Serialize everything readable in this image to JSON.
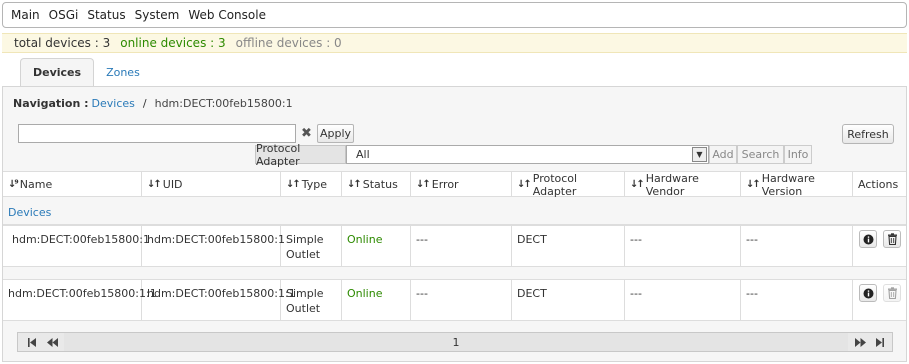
{
  "menu": [
    "Main",
    "OSGi",
    "Status",
    "System",
    "Web Console"
  ],
  "status": {
    "total": "total devices : 3",
    "online": "online devices : 3",
    "offline": "offline devices : 0"
  },
  "tabs": [
    {
      "label": "Devices",
      "active": true
    },
    {
      "label": "Zones",
      "active": false
    }
  ],
  "navigation": {
    "label": "Navigation :",
    "link": "Devices",
    "separator": "/",
    "current": "hdm:DECT:00feb15800:1"
  },
  "filter": {
    "value": "",
    "clear_icon": "✖",
    "apply_label": "Apply",
    "refresh_label": "Refresh"
  },
  "protocol": {
    "label": "Protocol Adapter",
    "selected": "All",
    "add_label": "Add",
    "search_label": "Search",
    "info_label": "Info"
  },
  "columns": {
    "name": "Name",
    "uid": "UID",
    "type": "Type",
    "status": "Status",
    "error": "Error",
    "protocol_adapter": "Protocol Adapter",
    "hardware_vendor": "Hardware Vendor",
    "hardware_version": "Hardware Version",
    "actions": "Actions"
  },
  "group": {
    "label": "Devices"
  },
  "rows": [
    {
      "name": "hdm:DECT:00feb15800:1",
      "uid": "hdm:DECT:00feb15800:1",
      "type_line1": "Simple",
      "type_line2": "Outlet",
      "status": "Online",
      "error": "---",
      "protocol_adapter": "DECT",
      "hardware_vendor": "---",
      "hardware_version": "---"
    },
    {
      "name": "hdm:DECT:00feb15800:1:1",
      "uid": "hdm:DECT:00feb15800:1:1",
      "type_line1": "Simple",
      "type_line2": "Outlet",
      "status": "Online",
      "error": "---",
      "protocol_adapter": "DECT",
      "hardware_vendor": "---",
      "hardware_version": "---"
    }
  ],
  "pager": {
    "page": "1"
  },
  "colors": {
    "link": "#2a7ab8",
    "online": "#2d8a00",
    "status_bar": "#fcf8e3"
  }
}
